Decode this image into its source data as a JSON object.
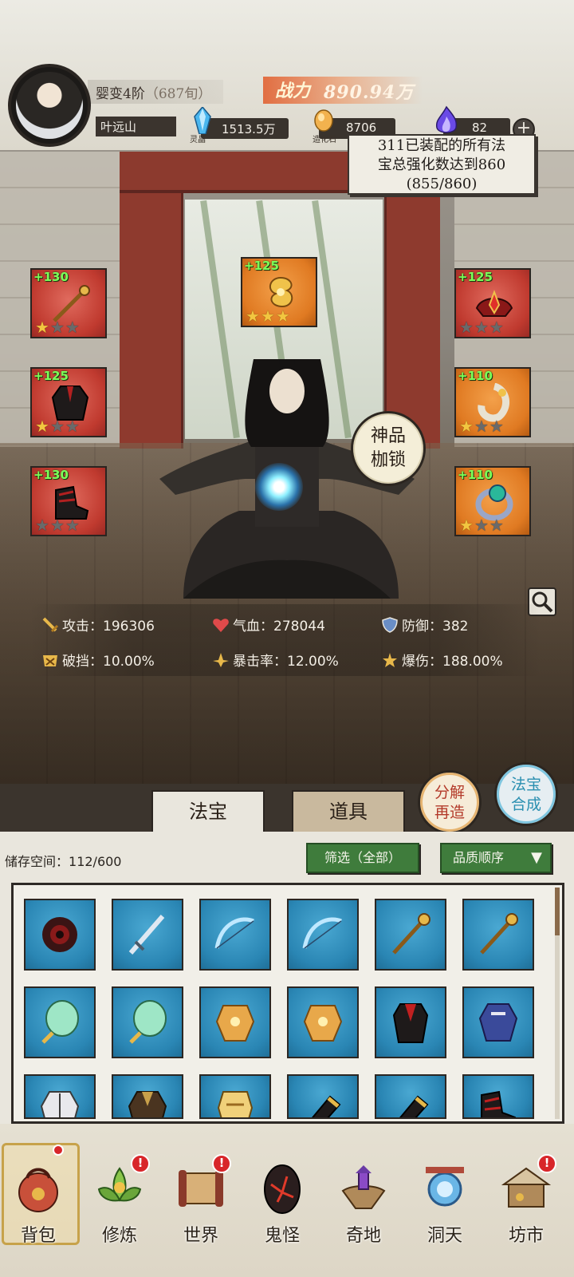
{
  "header": {
    "realm": "婴变4阶",
    "age": "（687旬）",
    "name": "叶远山",
    "power_label": "战力",
    "power_value": "890.94万",
    "resources": [
      {
        "label": "灵晶",
        "value": "1513.5万",
        "icon": "spirit-crystal-icon",
        "color": "#3aa8e6"
      },
      {
        "label": "造化石",
        "value": "8706",
        "icon": "creation-stone-icon",
        "color": "#e8a44a"
      },
      {
        "label": "",
        "value": "82",
        "icon": "soul-flame-icon",
        "color": "#6a4ae6"
      }
    ],
    "plus_label": "+"
  },
  "quest": {
    "line1": "311已装配的所有法",
    "line2": "宝总强化数达到860",
    "line3": "(855/860)"
  },
  "equipment": {
    "left": [
      {
        "level": "+130",
        "stars": 1,
        "icon": "golden-staff-icon",
        "bg": "red"
      },
      {
        "level": "+125",
        "stars": 1,
        "icon": "dark-robe-icon",
        "bg": "red"
      },
      {
        "level": "+130",
        "stars": 0,
        "icon": "dark-boots-icon",
        "bg": "red"
      }
    ],
    "center": {
      "level": "+125",
      "stars": 3,
      "icon": "golden-cloud-ornament-icon",
      "bg": "orange"
    },
    "right": [
      {
        "level": "+125",
        "stars": 0,
        "icon": "phoenix-crown-icon",
        "bg": "red"
      },
      {
        "level": "+110",
        "stars": 1,
        "icon": "jade-pendant-icon",
        "bg": "orange"
      },
      {
        "level": "+110",
        "stars": 1,
        "icon": "emerald-ring-icon",
        "bg": "orange"
      }
    ],
    "max_stars": 3
  },
  "skill_badge": {
    "line1": "神品",
    "line2": "枷锁"
  },
  "stats": [
    {
      "label": "攻击：",
      "value": "196306",
      "icon": "sword-icon"
    },
    {
      "label": "气血：",
      "value": "278044",
      "icon": "heart-icon"
    },
    {
      "label": "防御：",
      "value": "382",
      "icon": "shield-icon"
    },
    {
      "label": "破挡：",
      "value": "10.00%",
      "icon": "break-block-icon"
    },
    {
      "label": "暴击率：",
      "value": "12.00%",
      "icon": "crit-rate-icon"
    },
    {
      "label": "爆伤：",
      "value": "188.00%",
      "icon": "crit-damage-icon"
    }
  ],
  "tabs": {
    "treasure": "法宝",
    "items": "道具"
  },
  "actions": {
    "decompose_l1": "分解",
    "decompose_l2": "再造",
    "synth_l1": "法宝",
    "synth_l2": "合成"
  },
  "inventory": {
    "storage_label": "储存空间：",
    "storage_value": "112/600",
    "filter_label": "筛选（全部）",
    "sort_label": "品质顺序",
    "items": [
      "spiked-wheel-icon",
      "flying-sword-icon",
      "ice-bow-icon",
      "ice-bow-icon",
      "golden-staff-icon",
      "golden-staff-icon",
      "jade-fan-icon",
      "jade-fan-icon",
      "golden-armor-icon",
      "golden-armor-icon",
      "red-cloak-robe-icon",
      "blue-robe-icon",
      "white-armor-icon",
      "brown-robe-icon",
      "gold-chestplate-icon",
      "black-gauntlet-icon",
      "black-gauntlet-icon",
      "crimson-boots-icon"
    ]
  },
  "nav": [
    {
      "label": "背包",
      "icon": "bag-icon",
      "badge": "",
      "active": true
    },
    {
      "label": "修炼",
      "icon": "lotus-icon",
      "badge": "!"
    },
    {
      "label": "世界",
      "icon": "scroll-map-icon",
      "badge": "!"
    },
    {
      "label": "鬼怪",
      "icon": "demon-egg-icon",
      "badge": ""
    },
    {
      "label": "奇地",
      "icon": "floating-island-icon",
      "badge": ""
    },
    {
      "label": "洞天",
      "icon": "portal-icon",
      "badge": ""
    },
    {
      "label": "坊市",
      "icon": "market-stall-icon",
      "badge": "!"
    }
  ]
}
